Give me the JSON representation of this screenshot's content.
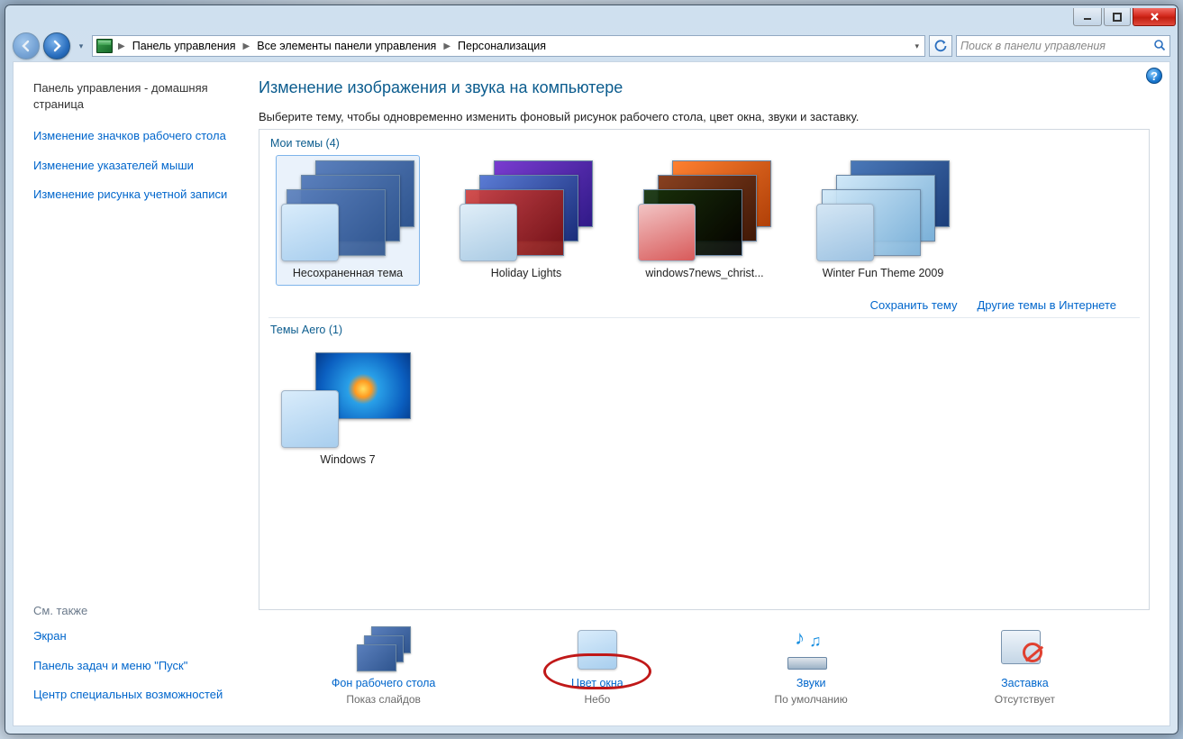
{
  "breadcrumb": {
    "seg1": "Панель управления",
    "seg2": "Все элементы панели управления",
    "seg3": "Персонализация"
  },
  "search": {
    "placeholder": "Поиск в панели управления"
  },
  "sidebar": {
    "home": "Панель управления - домашняя страница",
    "links": [
      "Изменение значков рабочего стола",
      "Изменение указателей мыши",
      "Изменение рисунка учетной записи"
    ],
    "see_also_header": "См. также",
    "see_also": [
      "Экран",
      "Панель задач и меню \"Пуск\"",
      "Центр специальных возможностей"
    ]
  },
  "page": {
    "heading": "Изменение изображения и звука на компьютере",
    "sub": "Выберите тему, чтобы одновременно изменить фоновый рисунок рабочего стола, цвет окна, звуки и заставку."
  },
  "groups": {
    "my": "Мои темы (4)",
    "aero": "Темы Aero (1)"
  },
  "themes": {
    "my": [
      {
        "label": "Несохраненная тема"
      },
      {
        "label": "Holiday Lights"
      },
      {
        "label": "windows7news_christ..."
      },
      {
        "label": "Winter Fun Theme 2009"
      }
    ],
    "aero": [
      {
        "label": "Windows 7"
      }
    ]
  },
  "links": {
    "save": "Сохранить тему",
    "online": "Другие темы в Интернете"
  },
  "bottom": {
    "bg": {
      "title": "Фон рабочего стола",
      "sub": "Показ слайдов"
    },
    "color": {
      "title": "Цвет окна",
      "sub": "Небо"
    },
    "sound": {
      "title": "Звуки",
      "sub": "По умолчанию"
    },
    "saver": {
      "title": "Заставка",
      "sub": "Отсутствует"
    }
  }
}
